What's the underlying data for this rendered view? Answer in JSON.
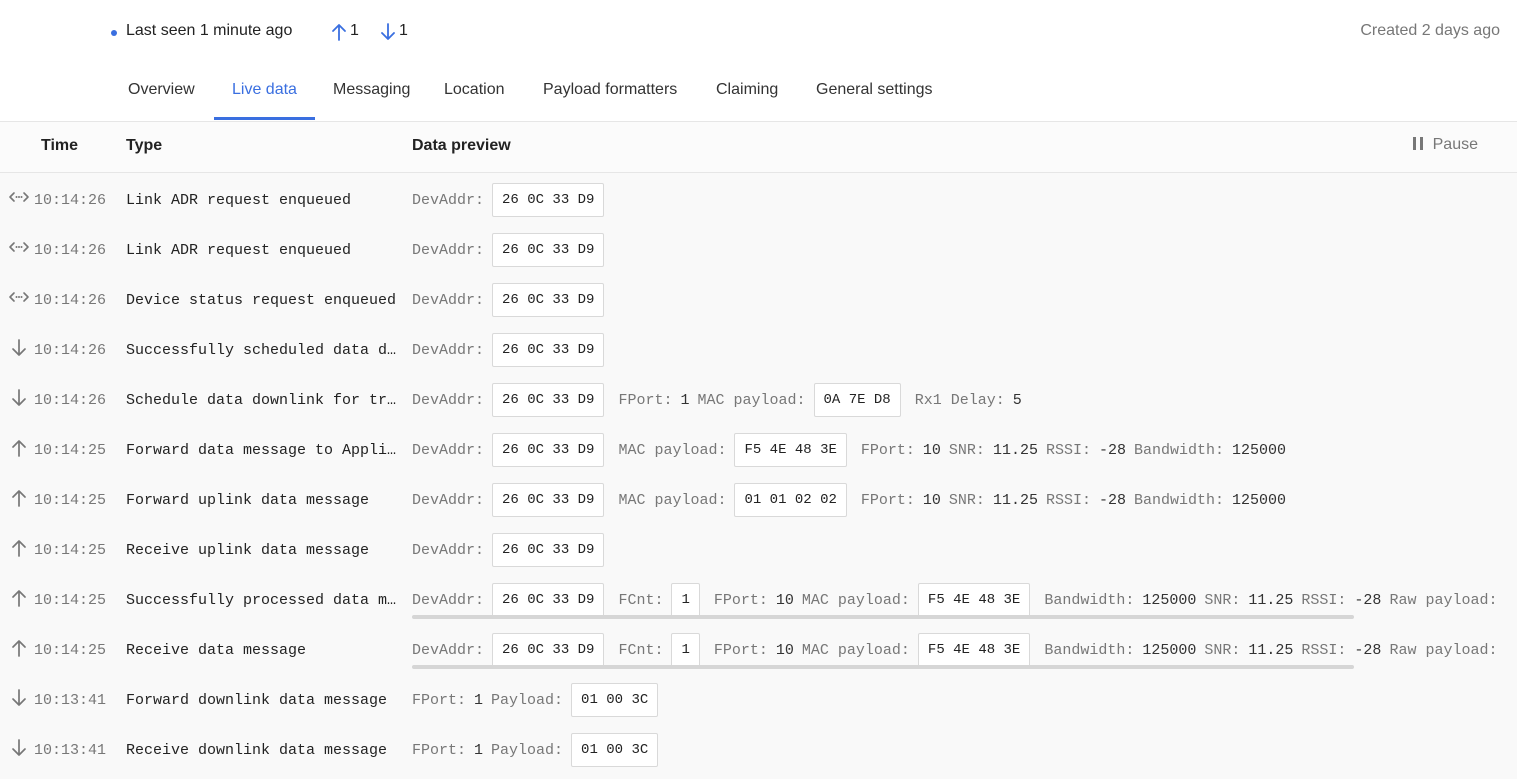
{
  "header": {
    "last_seen": "Last seen 1 minute ago",
    "uplink_count": "1",
    "downlink_count": "1",
    "created": "Created 2 days ago"
  },
  "tabs": [
    {
      "label": "Overview",
      "active": false
    },
    {
      "label": "Live data",
      "active": true
    },
    {
      "label": "Messaging",
      "active": false
    },
    {
      "label": "Location",
      "active": false
    },
    {
      "label": "Payload formatters",
      "active": false
    },
    {
      "label": "Claiming",
      "active": false
    },
    {
      "label": "General settings",
      "active": false
    }
  ],
  "table": {
    "columns": {
      "time": "Time",
      "type": "Type",
      "preview": "Data preview"
    },
    "pause_label": "Pause",
    "rows": [
      {
        "direction": "mac",
        "time": "10:14:26",
        "type": "Link ADR request enqueued",
        "fields": [
          {
            "label": "DevAddr:",
            "box": "26 0C 33 D9"
          }
        ]
      },
      {
        "direction": "mac",
        "time": "10:14:26",
        "type": "Link ADR request enqueued",
        "fields": [
          {
            "label": "DevAddr:",
            "box": "26 0C 33 D9"
          }
        ]
      },
      {
        "direction": "mac",
        "time": "10:14:26",
        "type": "Device status request enqueued",
        "fields": [
          {
            "label": "DevAddr:",
            "box": "26 0C 33 D9"
          }
        ]
      },
      {
        "direction": "down",
        "time": "10:14:26",
        "type": "Successfully scheduled data d…",
        "fields": [
          {
            "label": "DevAddr:",
            "box": "26 0C 33 D9"
          }
        ]
      },
      {
        "direction": "down",
        "time": "10:14:26",
        "type": "Schedule data downlink for tr…",
        "fields": [
          {
            "label": "DevAddr:",
            "box": "26 0C 33 D9"
          },
          {
            "label": "FPort:",
            "value": "1"
          },
          {
            "label": "MAC payload:",
            "box": "0A 7E D8"
          },
          {
            "label": "Rx1 Delay:",
            "value": "5"
          }
        ]
      },
      {
        "direction": "up",
        "time": "10:14:25",
        "type": "Forward data message to Appli…",
        "fields": [
          {
            "label": "DevAddr:",
            "box": "26 0C 33 D9"
          },
          {
            "label": "MAC payload:",
            "box": "F5 4E 48 3E"
          },
          {
            "label": "FPort:",
            "value": "10"
          },
          {
            "label": "SNR:",
            "value": "11.25"
          },
          {
            "label": "RSSI:",
            "value": "-28"
          },
          {
            "label": "Bandwidth:",
            "value": "125000"
          }
        ]
      },
      {
        "direction": "up",
        "time": "10:14:25",
        "type": "Forward uplink data message",
        "fields": [
          {
            "label": "DevAddr:",
            "box": "26 0C 33 D9"
          },
          {
            "label": "MAC payload:",
            "box": "01 01 02 02"
          },
          {
            "label": "FPort:",
            "value": "10"
          },
          {
            "label": "SNR:",
            "value": "11.25"
          },
          {
            "label": "RSSI:",
            "value": "-28"
          },
          {
            "label": "Bandwidth:",
            "value": "125000"
          }
        ]
      },
      {
        "direction": "up",
        "time": "10:14:25",
        "type": "Receive uplink data message",
        "fields": [
          {
            "label": "DevAddr:",
            "box": "26 0C 33 D9"
          }
        ]
      },
      {
        "direction": "up",
        "time": "10:14:25",
        "type": "Successfully processed data m…",
        "scroll": true,
        "fields": [
          {
            "label": "DevAddr:",
            "box": "26 0C 33 D9"
          },
          {
            "label": "FCnt:",
            "box": "1"
          },
          {
            "label": "FPort:",
            "value": "10"
          },
          {
            "label": "MAC payload:",
            "box": "F5 4E 48 3E"
          },
          {
            "label": "Bandwidth:",
            "value": "125000"
          },
          {
            "label": "SNR:",
            "value": "11.25"
          },
          {
            "label": "RSSI:",
            "value": "-28"
          },
          {
            "label": "Raw payload:",
            "value": ""
          }
        ]
      },
      {
        "direction": "up",
        "time": "10:14:25",
        "type": "Receive data message",
        "scroll": true,
        "fields": [
          {
            "label": "DevAddr:",
            "box": "26 0C 33 D9"
          },
          {
            "label": "FCnt:",
            "box": "1"
          },
          {
            "label": "FPort:",
            "value": "10"
          },
          {
            "label": "MAC payload:",
            "box": "F5 4E 48 3E"
          },
          {
            "label": "Bandwidth:",
            "value": "125000"
          },
          {
            "label": "SNR:",
            "value": "11.25"
          },
          {
            "label": "RSSI:",
            "value": "-28"
          },
          {
            "label": "Raw payload:",
            "value": ""
          }
        ]
      },
      {
        "direction": "down",
        "time": "10:13:41",
        "type": "Forward downlink data message",
        "fields": [
          {
            "label": "FPort:",
            "value": "1"
          },
          {
            "label": "Payload:",
            "box": "01 00 3C"
          }
        ]
      },
      {
        "direction": "down",
        "time": "10:13:41",
        "type": "Receive downlink data message",
        "fields": [
          {
            "label": "FPort:",
            "value": "1"
          },
          {
            "label": "Payload:",
            "box": "01 00 3C"
          }
        ]
      }
    ]
  },
  "colors": {
    "accent": "#3a6fe0",
    "muted": "#777777"
  },
  "icons": {
    "up": "arrow-up-icon",
    "down": "arrow-down-icon",
    "mac": "mac-command-icon",
    "pause": "pause-icon"
  }
}
